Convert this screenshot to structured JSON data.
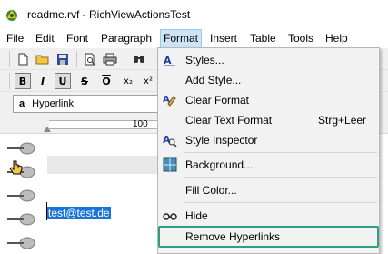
{
  "window": {
    "title": "readme.rvf - RichViewActionsTest",
    "icon": "app-icon"
  },
  "menubar": {
    "items": [
      "File",
      "Edit",
      "Font",
      "Paragraph",
      "Format",
      "Insert",
      "Table",
      "Tools",
      "Help"
    ],
    "active": "Format"
  },
  "toolbar1": {
    "icons": [
      "new-document-icon",
      "open-folder-icon",
      "save-icon",
      "print-preview-icon",
      "print-icon",
      "find-icon"
    ]
  },
  "toolbar2": {
    "bold": "B",
    "italic": "I",
    "underline": "U",
    "strikethrough": "S",
    "overline": "O",
    "subscript": "x₂",
    "superscript": "x²"
  },
  "style_combo": {
    "glyph": "a",
    "value": "Hyperlink"
  },
  "ruler": {
    "mark": "100"
  },
  "document": {
    "link_text": "test@test.de"
  },
  "format_menu": {
    "items": [
      {
        "label": "Styles...",
        "icon": "styles-icon",
        "shortcut": ""
      },
      {
        "label": "Add Style...",
        "icon": "",
        "shortcut": ""
      },
      {
        "label": "Clear Format",
        "icon": "clear-format-icon",
        "shortcut": ""
      },
      {
        "label": "Clear Text Format",
        "icon": "",
        "shortcut": "Strg+Leer"
      },
      {
        "label": "Style Inspector",
        "icon": "style-inspector-icon",
        "shortcut": ""
      },
      {
        "label": "Background...",
        "icon": "background-icon",
        "shortcut": ""
      },
      {
        "label": "Fill Color...",
        "icon": "",
        "shortcut": ""
      },
      {
        "label": "Hide",
        "icon": "hide-icon",
        "shortcut": ""
      },
      {
        "label": "Remove Hyperlinks",
        "icon": "",
        "shortcut": ""
      }
    ],
    "highlight_color": "#2e9e86"
  },
  "colors": {
    "menu_active": "#cce4f7",
    "selection": "#1a73d9"
  }
}
